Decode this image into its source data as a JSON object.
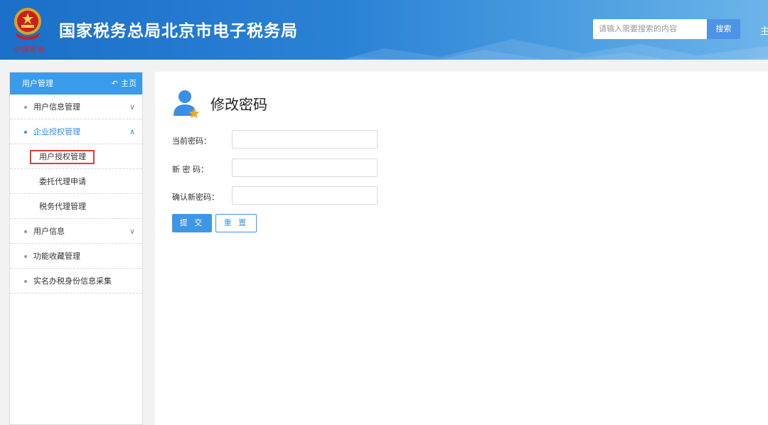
{
  "header": {
    "site_title": "国家税务总局北京市电子税务局",
    "signature": "中国税务",
    "search_placeholder": "请输入需要搜索的内容",
    "search_button": "搜索",
    "home_link": "主"
  },
  "sidebar": {
    "title": "用户管理",
    "home_label": "主页",
    "items": [
      {
        "label": "用户信息管理",
        "expanded": false
      },
      {
        "label": "企业授权管理",
        "expanded": true,
        "children": [
          {
            "label": "用户授权管理",
            "highlighted": true
          },
          {
            "label": "委托代理申请"
          },
          {
            "label": "税务代理管理"
          }
        ]
      },
      {
        "label": "用户信息",
        "expanded": false
      },
      {
        "label": "功能收藏管理"
      },
      {
        "label": "实名办税身份信息采集"
      }
    ]
  },
  "main": {
    "title": "修改密码",
    "fields": [
      {
        "label": "当前密码：",
        "value": ""
      },
      {
        "label": "新 密 码：",
        "value": ""
      },
      {
        "label": "确认新密码：",
        "value": ""
      }
    ],
    "submit_label": "提 交",
    "reset_label": "重 置"
  },
  "colors": {
    "header_blue": "#1b6fc8",
    "accent": "#3e96e6",
    "highlight_border": "#e23a3a"
  }
}
